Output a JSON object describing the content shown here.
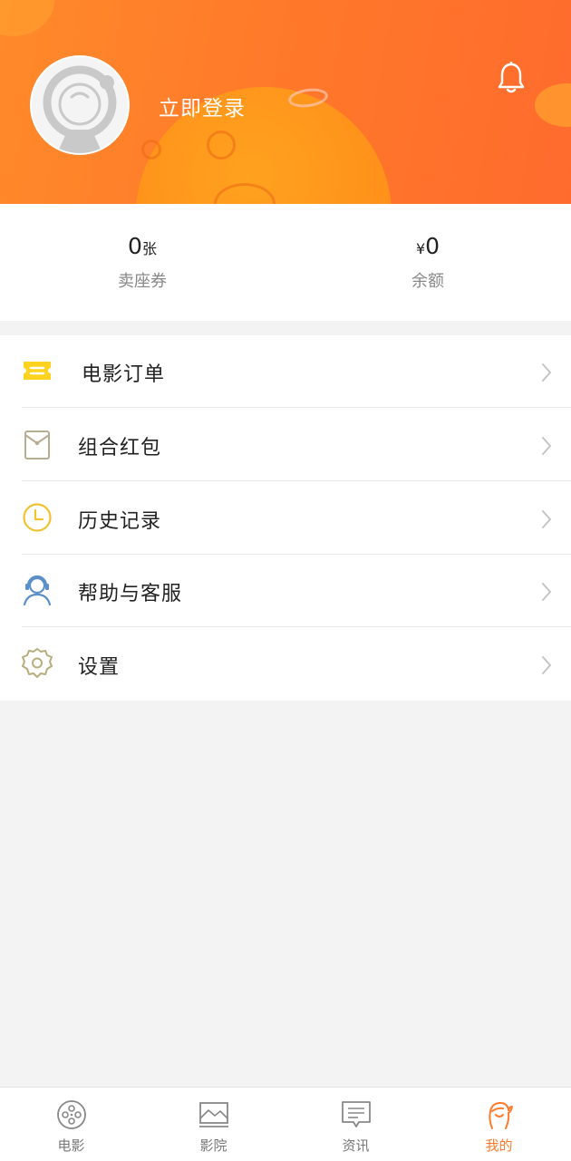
{
  "header": {
    "login_text": "立即登录"
  },
  "stats": {
    "tickets": {
      "value": "0",
      "unit": "张",
      "label": "卖座券"
    },
    "balance": {
      "currency": "¥",
      "value": "0",
      "label": "余额"
    }
  },
  "menu": {
    "items": [
      {
        "label": "电影订单",
        "icon": "ticket-icon"
      },
      {
        "label": "组合红包",
        "icon": "red-envelope-icon"
      },
      {
        "label": "历史记录",
        "icon": "clock-icon"
      },
      {
        "label": "帮助与客服",
        "icon": "customer-service-icon"
      },
      {
        "label": "设置",
        "icon": "gear-icon"
      }
    ]
  },
  "tabs": [
    {
      "label": "电影",
      "icon": "film-reel-icon",
      "active": false
    },
    {
      "label": "影院",
      "icon": "cinema-icon",
      "active": false
    },
    {
      "label": "资讯",
      "icon": "news-icon",
      "active": false
    },
    {
      "label": "我的",
      "icon": "profile-icon",
      "active": true
    }
  ],
  "colors": {
    "brand_orange": "#ff7a2a",
    "ticket_yellow": "#ffd21f",
    "clock_yellow": "#f1c232",
    "service_blue": "#5a8fc8"
  }
}
